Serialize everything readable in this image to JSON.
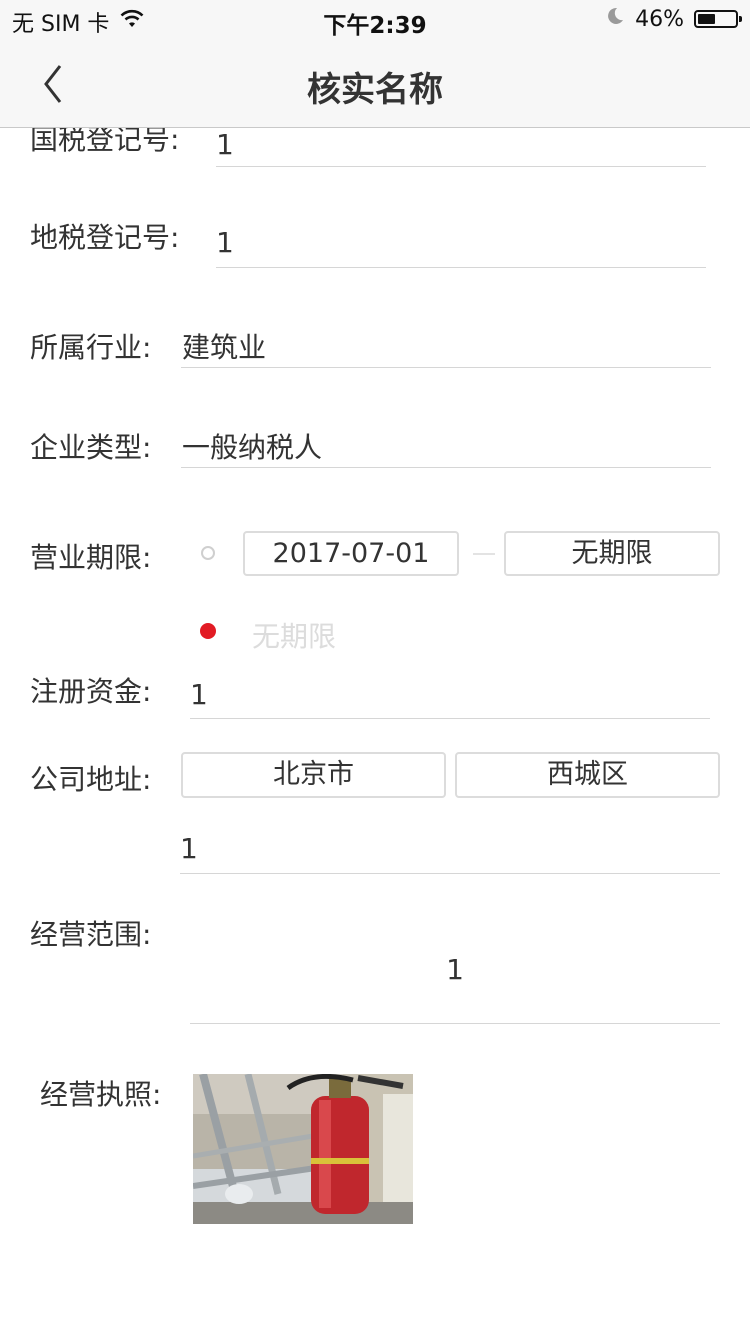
{
  "status": {
    "carrier": "无 SIM 卡",
    "time": "下午2:39",
    "battery": "46%",
    "battery_level": 0.46
  },
  "nav": {
    "title": "核实名称",
    "back_icon": "chevron-left-icon"
  },
  "form": {
    "national_tax": {
      "label": "国税登记号:",
      "value": "1"
    },
    "local_tax": {
      "label": "地税登记号:",
      "value": "1"
    },
    "industry": {
      "label": "所属行业:",
      "value": "建筑业"
    },
    "company_type": {
      "label": "企业类型:",
      "value": "一般纳税人"
    },
    "business_term": {
      "label": "营业期限:",
      "start_date": "2017-07-01",
      "end_date": "无期限",
      "unlimited_label": "无期限"
    },
    "capital": {
      "label": "注册资金:",
      "value": "1"
    },
    "address": {
      "label": "公司地址:",
      "city": "北京市",
      "district": "西城区",
      "detail": "1"
    },
    "scope": {
      "label": "经营范围:",
      "value": "1"
    },
    "license": {
      "label": "经营执照:"
    }
  },
  "colors": {
    "accent_red": "#e21b24",
    "divider": "#d6d6d6",
    "nav_bg": "#f7f7f7"
  }
}
